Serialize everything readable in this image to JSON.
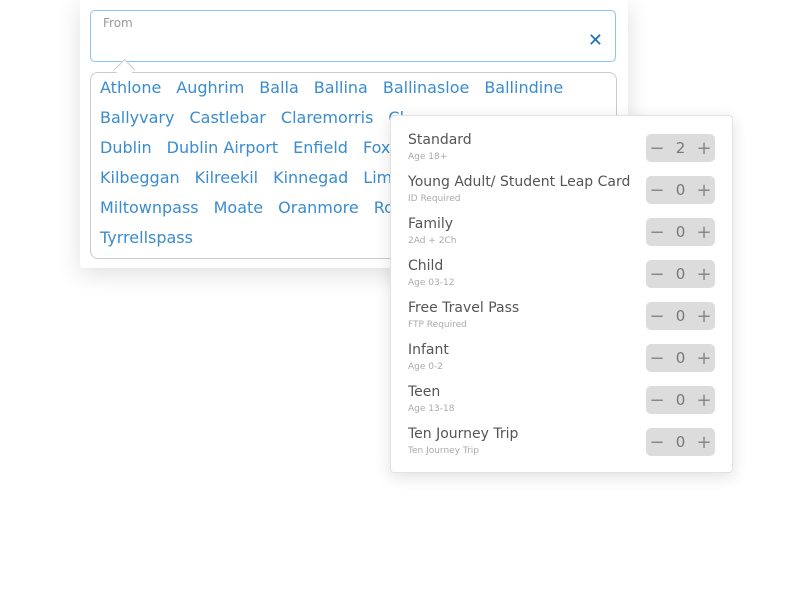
{
  "from": {
    "label": "From",
    "value": "",
    "clear_icon": "close-icon"
  },
  "stations": [
    [
      "Athlone",
      "Aughrim",
      "Balla",
      "Ballina",
      "Ballinasloe",
      "Ballindine"
    ],
    [
      "Ballyvary",
      "Castlebar",
      "Claremorris",
      "Cl"
    ],
    [
      "Dublin",
      "Dublin Airport",
      "Enfield",
      "Foxf"
    ],
    [
      "Kilbeggan",
      "Kilreekil",
      "Kinnegad",
      "Lime"
    ],
    [
      "Miltownpass",
      "Moate",
      "Oranmore",
      "Ro"
    ],
    [
      "Tyrrellspass"
    ]
  ],
  "passengers": [
    {
      "label": "Standard",
      "sub": "Age 18+",
      "count": "2"
    },
    {
      "label": "Young Adult/ Student Leap Card",
      "sub": "ID Required",
      "count": "0"
    },
    {
      "label": "Family",
      "sub": "2Ad + 2Ch",
      "count": "0"
    },
    {
      "label": "Child",
      "sub": "Age 03-12",
      "count": "0"
    },
    {
      "label": "Free Travel Pass",
      "sub": "FTP Required",
      "count": "0"
    },
    {
      "label": "Infant",
      "sub": "Age 0-2",
      "count": "0"
    },
    {
      "label": "Teen",
      "sub": "Age 13-18",
      "count": "0"
    },
    {
      "label": "Ten Journey Trip",
      "sub": "Ten Journey Trip",
      "count": "0"
    }
  ],
  "stepper": {
    "minus": "−",
    "plus": "+"
  },
  "colors": {
    "link": "#3a8ccf",
    "input_border": "#8cc4ee",
    "clear": "#1f6fb5",
    "stepper_bg": "#dcdcdc"
  }
}
